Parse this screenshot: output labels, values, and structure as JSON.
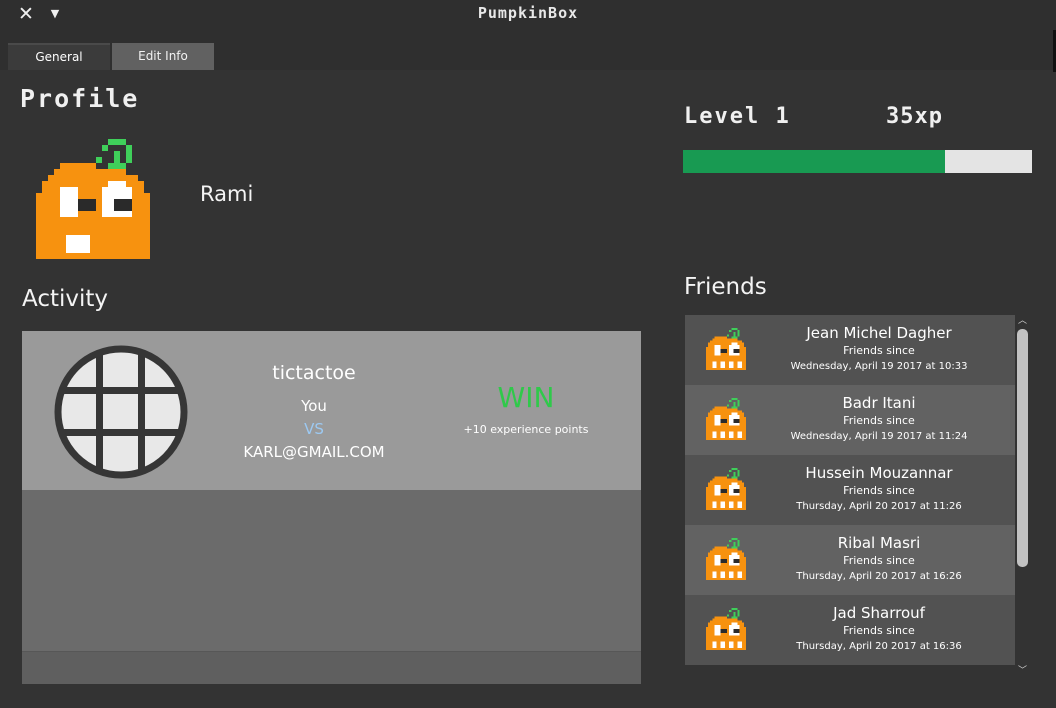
{
  "window": {
    "title": "PumpkinBox",
    "close_icon": "close-icon",
    "menu_icon": "chevron-down-icon"
  },
  "tabs": [
    {
      "label": "General",
      "active": true
    },
    {
      "label": "Edit Info",
      "active": false
    }
  ],
  "profile": {
    "heading": "Profile",
    "username": "Rami",
    "avatar_icon": "pumpkin-avatar-icon"
  },
  "level": {
    "label": "Level 1",
    "xp": "35xp",
    "progress": 0.75,
    "bar_color": "#189a52",
    "track_color": "#e4e4e4"
  },
  "activity": {
    "heading": "Activity",
    "items": [
      {
        "game": "tictactoe",
        "game_icon": "tictactoe-board-icon",
        "player": "You",
        "vs": "VS",
        "opponent": "KARL@GMAIL.COM",
        "result": "WIN",
        "result_color": "#2fc94a",
        "points": "+10 experience points"
      }
    ]
  },
  "friends": {
    "heading": "Friends",
    "items": [
      {
        "name": "Jean Michel Dagher",
        "since_label": "Friends since",
        "date": "Wednesday, April 19 2017 at 10:33"
      },
      {
        "name": "Badr Itani",
        "since_label": "Friends since",
        "date": "Wednesday, April 19 2017 at 11:24"
      },
      {
        "name": "Hussein Mouzannar",
        "since_label": "Friends since",
        "date": "Thursday, April 20 2017 at 11:26"
      },
      {
        "name": "Ribal Masri",
        "since_label": "Friends since",
        "date": "Thursday, April 20 2017 at 16:26"
      },
      {
        "name": "Jad Sharrouf",
        "since_label": "Friends since",
        "date": "Thursday, April 20 2017 at 16:36"
      }
    ]
  },
  "colors": {
    "accent_green": "#189a52",
    "pumpkin_orange": "#f7920f",
    "stem_green": "#3fcf5a",
    "vs_blue": "#9cc9f2"
  }
}
